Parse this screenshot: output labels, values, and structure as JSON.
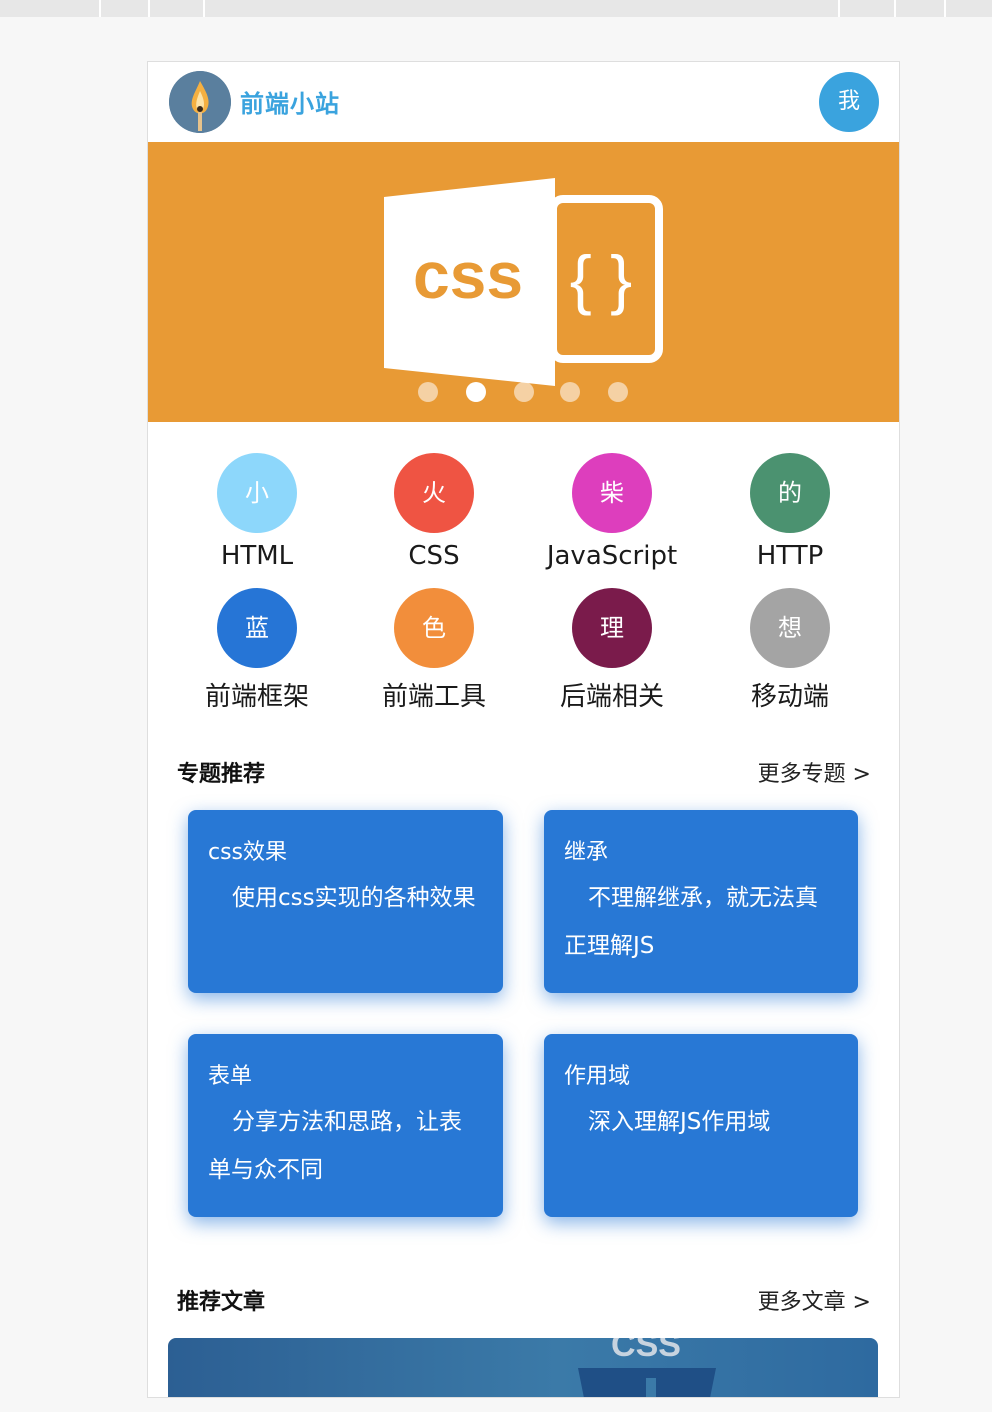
{
  "header": {
    "brand": "前端小站",
    "profile_label": "我"
  },
  "banner": {
    "badge_text": "css",
    "braces": "{ }",
    "active_slide": 2,
    "slide_count": 5
  },
  "categories": [
    {
      "glyph": "小",
      "label": "HTML",
      "color": "#8dd7fb"
    },
    {
      "glyph": "火",
      "label": "CSS",
      "color": "#ef5443"
    },
    {
      "glyph": "柴",
      "label": "JavaScript",
      "color": "#dd3ebd"
    },
    {
      "glyph": "的",
      "label": "HTTP",
      "color": "#4b9270"
    },
    {
      "glyph": "蓝",
      "label": "前端框架",
      "color": "#2675d6"
    },
    {
      "glyph": "色",
      "label": "前端工具",
      "color": "#f28e3b"
    },
    {
      "glyph": "理",
      "label": "后端相关",
      "color": "#7a1b4b"
    },
    {
      "glyph": "想",
      "label": "移动端",
      "color": "#a4a4a4"
    }
  ],
  "topics": {
    "title": "专题推荐",
    "more": "更多专题 >",
    "cards": [
      {
        "title": "css效果",
        "desc": "使用css实现的各种效果"
      },
      {
        "title": "继承",
        "desc": "不理解继承，就无法真正理解JS"
      },
      {
        "title": "表单",
        "desc": "分享方法和思路，让表单与众不同"
      },
      {
        "title": "作用域",
        "desc": "深入理解JS作用域"
      }
    ]
  },
  "articles": {
    "title": "推荐文章",
    "more": "更多文章 >",
    "thumb_text": "CSS"
  },
  "colors": {
    "brand": "#3aa3de",
    "banner": "#e89a35",
    "card": "#2878d5"
  }
}
